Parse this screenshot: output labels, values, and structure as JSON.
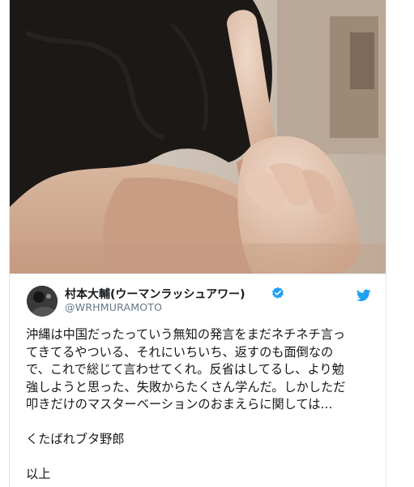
{
  "tweet": {
    "display_name": "村本大輔(ウーマンラッシュアワー)",
    "handle": "@WRHMURAMOTO",
    "body_lines": [
      "沖縄は中国だったっていう無知の発言をまだネチネチ言っ",
      "てきてるやついる、それにいちいち、返すのも面倒なの",
      "で、これで総じて言わせてくれ。反省はしてるし、より勉",
      "強しようと思った、失敗からたくさん学んだ。しかしただ",
      "叩きだけのマスターベーションのおまえらに関しては…"
    ],
    "closing_line_1": "くたばれブタ野郎",
    "closing_line_2": "以上"
  },
  "icons": {
    "avatar": "avatar-icon",
    "verified": "verified-badge-icon",
    "brand": "twitter-bird-icon"
  },
  "colors": {
    "verified_blue": "#1da1f2",
    "twitter_blue": "#1da1f2",
    "text_primary": "#14171a",
    "text_secondary": "#657786"
  }
}
